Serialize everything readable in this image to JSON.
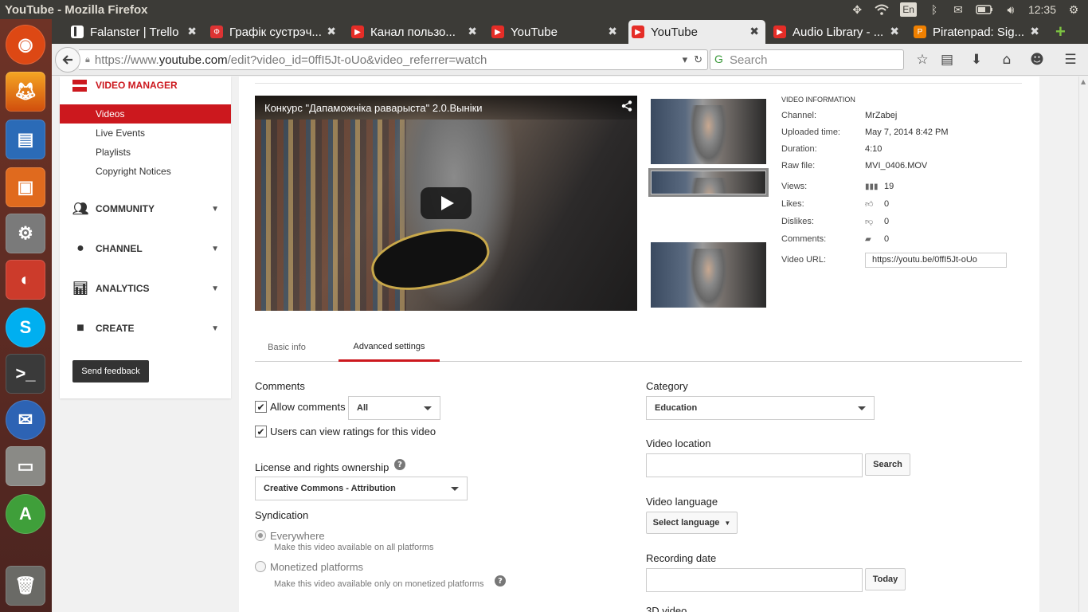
{
  "system": {
    "window_title": "YouTube - Mozilla Firefox",
    "input_lang": "En",
    "clock": "12:35"
  },
  "launcher": {
    "items": [
      "ubuntu-icon",
      "firefox-icon",
      "writer-icon",
      "impress-icon",
      "settings-icon",
      "docky-icon",
      "skype-icon",
      "terminal-icon",
      "thunderbird-icon",
      "files-icon",
      "software-center-icon",
      "trash-icon"
    ]
  },
  "tabs": [
    {
      "title": "Falanster | Trello",
      "favicon": "trello-icon",
      "color": "#333"
    },
    {
      "title": "Графік сустрэч...",
      "favicon": "tab-app-icon",
      "color": "#d33"
    },
    {
      "title": "Канал пользо...",
      "favicon": "youtube-icon",
      "color": "#e52d27"
    },
    {
      "title": "YouTube",
      "favicon": "youtube-icon",
      "color": "#e52d27"
    },
    {
      "title": "YouTube",
      "favicon": "youtube-icon",
      "color": "#e52d27"
    },
    {
      "title": "Audio Library - ...",
      "favicon": "youtube-icon",
      "color": "#e52d27"
    },
    {
      "title": "Piratenpad: Sig...",
      "favicon": "piratenpad-icon",
      "color": "#f08000"
    }
  ],
  "navbar": {
    "url_prefix": "https://www.",
    "url_domain": "youtube.com",
    "url_rest": "/edit?video_id=0ffI5Jt-oUo&video_referrer=watch",
    "search_placeholder": "Search"
  },
  "sidebar": {
    "title": "VIDEO MANAGER",
    "items": [
      "Videos",
      "Live Events",
      "Playlists",
      "Copyright Notices"
    ],
    "sections": [
      "COMMUNITY",
      "CHANNEL",
      "ANALYTICS",
      "CREATE"
    ],
    "feedback": "Send feedback"
  },
  "player": {
    "title": "Конкурс \"Дапаможніка раварыста\" 2.0.Выніки"
  },
  "video_info": {
    "heading": "VIDEO INFORMATION",
    "channel_label": "Channel:",
    "channel": "MrZabej",
    "uploaded_label": "Uploaded time:",
    "uploaded": "May 7, 2014 8:42 PM",
    "duration_label": "Duration:",
    "duration": "4:10",
    "raw_label": "Raw file:",
    "raw": "MVI_0406.MOV",
    "views_label": "Views:",
    "views": "19",
    "likes_label": "Likes:",
    "likes": "0",
    "dislikes_label": "Dislikes:",
    "dislikes": "0",
    "comments_label": "Comments:",
    "comments": "0",
    "url_label": "Video URL:",
    "url": "https://youtu.be/0ffI5Jt-oUo"
  },
  "page_tabs": [
    "Basic info",
    "Advanced settings"
  ],
  "form": {
    "comments_label": "Comments",
    "allow_comments": "Allow comments",
    "comments_select": "All",
    "view_ratings": "Users can view ratings for this video",
    "license_label": "License and rights ownership",
    "license_value": "Creative Commons - Attribution",
    "syndication_label": "Syndication",
    "everywhere": "Everywhere",
    "everywhere_sub": "Make this video available on all platforms",
    "monetized": "Monetized platforms",
    "monetized_sub": "Make this video available only on monetized platforms",
    "category_label": "Category",
    "category_value": "Education",
    "location_label": "Video location",
    "location_button": "Search",
    "language_label": "Video language",
    "language_button": "Select language",
    "recording_label": "Recording date",
    "today_button": "Today",
    "threed_label": "3D video"
  }
}
